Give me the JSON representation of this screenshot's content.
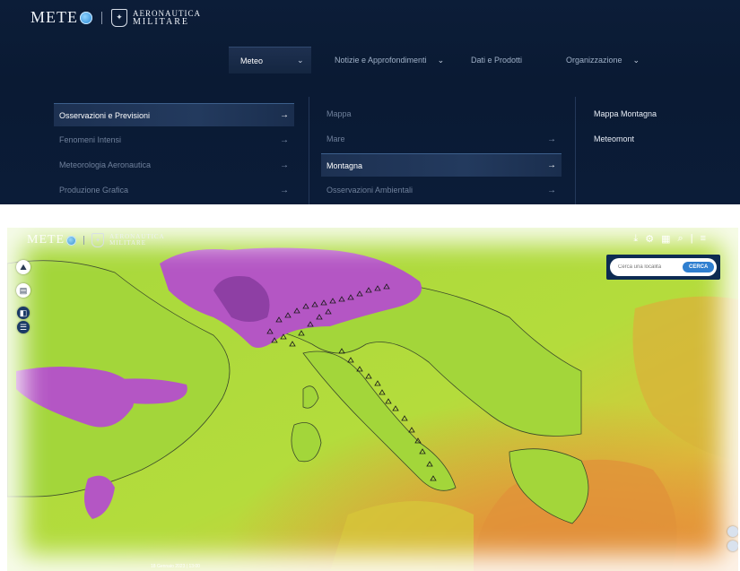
{
  "brand": {
    "name": "METE",
    "am_line1": "AERONAUTICA",
    "am_line2": "MILITARE"
  },
  "nav": {
    "items": [
      "Meteo",
      "Notizie e Approfondimenti",
      "Dati e Prodotti",
      "Organizzazione"
    ],
    "active_index": 0
  },
  "menu": {
    "col1": [
      "Osservazioni e Previsioni",
      "Fenomeni Intensi",
      "Meteorologia Aeronautica",
      "Produzione Grafica"
    ],
    "col2": [
      "Mappa",
      "Mare",
      "Montagna",
      "Osservazioni Ambientali"
    ],
    "col3": [
      "Mappa Montagna",
      "Meteomont"
    ],
    "arrow": "→"
  },
  "map": {
    "search_placeholder": "Cerca una località",
    "search_button": "CERCA",
    "timestamp": "18 Gennaio 2023 | 13:00"
  },
  "colors": {
    "header_bg": "#0a1a33",
    "snow_purple": "#b04fbf",
    "land_green": "#9fd43a",
    "accent_blue": "#2f7fd0"
  }
}
